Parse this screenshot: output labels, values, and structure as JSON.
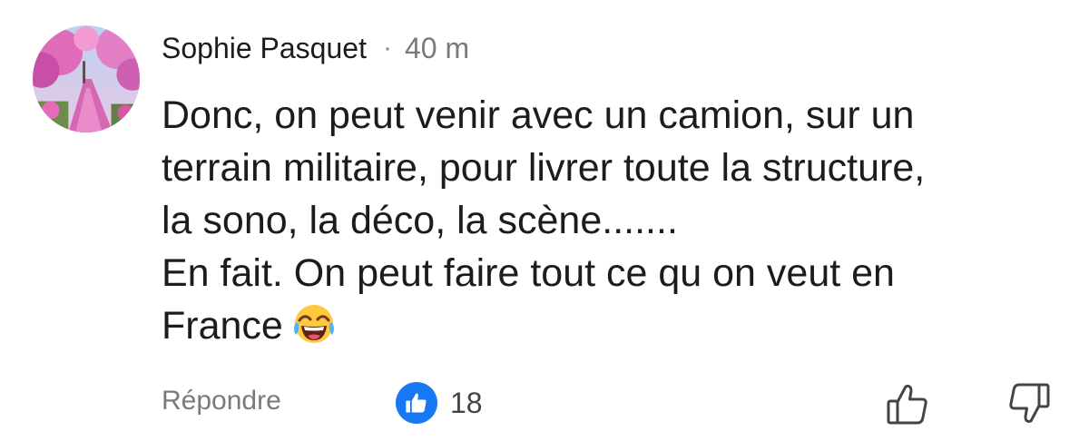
{
  "comment": {
    "author": "Sophie Pasquet",
    "separator": "·",
    "time": "40 m",
    "lines": [
      "Donc, on peut venir avec un camion, sur un",
      "terrain militaire, pour livrer toute la structure,",
      "la sono, la déco, la scène.......",
      "En fait. On peut faire tout ce qu on veut en",
      "France"
    ],
    "emoji": "face-with-tears-of-joy"
  },
  "actions": {
    "reply_label": "Répondre",
    "like_count": "18",
    "like_icon": "thumbs-up-icon",
    "vote_up_icon": "thumb-up-outline-icon",
    "vote_down_icon": "thumb-down-outline-icon"
  },
  "colors": {
    "like_badge": "#1877f2",
    "secondary_text": "#7a7a7a",
    "primary_text": "#1c1c1c"
  }
}
